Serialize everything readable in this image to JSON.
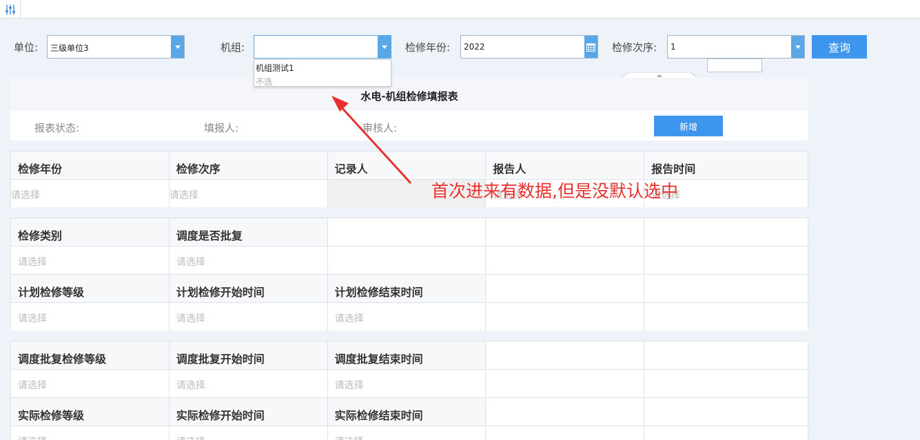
{
  "filters": {
    "unit_label": "单位:",
    "unit_value": "三级单位3",
    "group_label": "机组:",
    "group_value": "",
    "year_label": "检修年份:",
    "year_value": "2022",
    "order_label": "检修次序:",
    "order_value": "1",
    "query_label": "查询"
  },
  "dropdown": {
    "options": [
      "机组测试1",
      "不选"
    ]
  },
  "report": {
    "title": "水电-机组检修填报表",
    "status_label": "报表状态:",
    "filler_label": "填报人:",
    "reviewer_label": "审核人:",
    "add_label": "新增"
  },
  "grid1": {
    "headers": [
      "检修年份",
      "检修次序",
      "记录人",
      "报告人",
      "报告时间"
    ],
    "placeholder": "请选择"
  },
  "grid2": {
    "row1_headers": [
      "检修类别",
      "调度是否批复"
    ],
    "row2_headers": [
      "计划检修等级",
      "计划检修开始时间",
      "计划检修结束时间"
    ],
    "placeholder": "请选择"
  },
  "grid3": {
    "row1_headers": [
      "调度批复检修等级",
      "调度批复开始时间",
      "调度批复结束时间"
    ],
    "row2_headers": [
      "实际检修等级",
      "实际检修开始时间",
      "实际检修结束时间"
    ],
    "placeholder": "请选择"
  },
  "annotation": {
    "text": "首次进来有数据,但是没默认选中",
    "color": "#e8302f"
  },
  "colors": {
    "accent": "#3e95ee",
    "combo_button": "#5aa7e8"
  }
}
